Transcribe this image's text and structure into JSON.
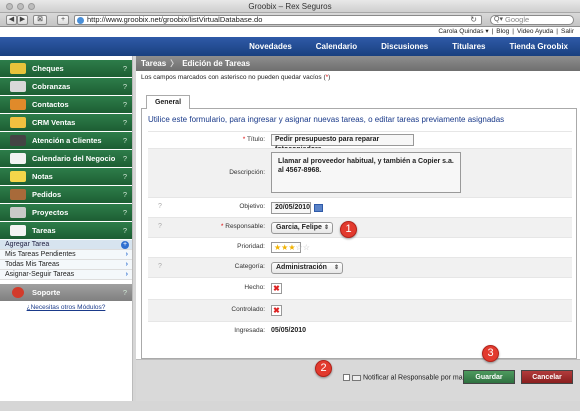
{
  "window": {
    "title": "Groobix – Rex Seguros"
  },
  "browser": {
    "url": "http://www.groobix.net/groobix/listVirtualDatabase.do",
    "search_placeholder": "Google"
  },
  "topbar": {
    "items": [
      "Carola Quindas ▾",
      "|",
      "Blog",
      "|",
      "Video Ayuda",
      "|",
      "Salir"
    ]
  },
  "nav": {
    "items": [
      "Novedades",
      "Calendario",
      "Discusiones",
      "Titulares",
      "Tienda Groobix"
    ]
  },
  "sidebar": {
    "items": [
      {
        "label": "Cheques",
        "q": "?",
        "color": "#e8c33b"
      },
      {
        "label": "Cobranzas",
        "q": "?",
        "color": "#d8d8d8"
      },
      {
        "label": "Contactos",
        "q": "?",
        "color": "#e08a2a"
      },
      {
        "label": "CRM Ventas",
        "q": "?",
        "color": "#f0c040"
      },
      {
        "label": "Atención a Clientes",
        "q": "?",
        "color": "#444444"
      },
      {
        "label": "Calendario del Negocio",
        "q": "?",
        "color": "#f2f2f2"
      },
      {
        "label": "Notas",
        "q": "?",
        "color": "#f4d64a"
      },
      {
        "label": "Pedidos",
        "q": "?",
        "color": "#a86a3a"
      },
      {
        "label": "Proyectos",
        "q": "?",
        "color": "#c9c9c9"
      },
      {
        "label": "Tareas",
        "q": "?",
        "color": "#f4f4f4"
      }
    ],
    "subitems": [
      "Agregar Tarea",
      "Mis Tareas Pendientes",
      "Todas Mis Tareas",
      "Asignar-Seguir Tareas"
    ],
    "support": {
      "label": "Soporte",
      "q": "?"
    },
    "more_link": "¿Necesitas otros Módulos?"
  },
  "breadcrumb": {
    "section": "Tareas",
    "page": "Edición de Tareas"
  },
  "required_note": {
    "text": "Los campos marcados con asterisco no pueden quedar vacíos (",
    "star": "*",
    "end": ")"
  },
  "tab": "General",
  "intro": "Utilice este formulario, para ingresar y asignar nuevas tareas, o editar tareas previamente asignadas",
  "form": {
    "titulo": {
      "label": "Título:",
      "value": "Pedir presupuesto para reparar fotocopiadora"
    },
    "descripcion": {
      "label": "Descripción:",
      "value": "Llamar al proveedor habitual, y también a Copier s.a. al 4567-8968."
    },
    "objetivo": {
      "label": "Objetivo:",
      "value": "20/05/2010"
    },
    "responsable": {
      "label": "Responsable:",
      "value": "Garcia, Felipe"
    },
    "prioridad": {
      "label": "Prioridad:",
      "stars": 3,
      "max": 5
    },
    "categoria": {
      "label": "Categoría:",
      "value": "Administración"
    },
    "hecho": {
      "label": "Hecho:",
      "mark": "✖"
    },
    "controlado": {
      "label": "Controlado:",
      "mark": "✖"
    },
    "ingresada": {
      "label": "Ingresada:",
      "value": "05/05/2010"
    }
  },
  "help": "?",
  "asterisk": "*",
  "footer": {
    "notify": "Notificar al Responsable por mail.",
    "save": "Guardar",
    "cancel": "Cancelar"
  },
  "callouts": [
    "1",
    "2",
    "3"
  ],
  "callout_color": "#e23a2e"
}
